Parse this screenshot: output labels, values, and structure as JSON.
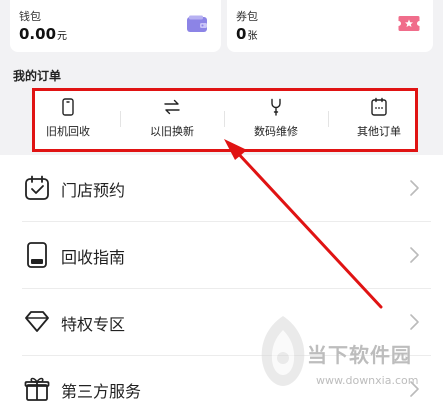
{
  "wallet": {
    "title": "钱包",
    "value": "0.00",
    "unit": "元",
    "icon": "wallet-icon",
    "icon_color": "#8c84e6"
  },
  "coupon": {
    "title": "券包",
    "value": "0",
    "unit": "张",
    "icon": "ticket-icon",
    "icon_color": "#f06d8b"
  },
  "orders": {
    "title": "我的订单",
    "highlight_color": "#e01313",
    "items": [
      {
        "label": "旧机回收",
        "icon": "phone-icon"
      },
      {
        "label": "以旧换新",
        "icon": "swap-icon"
      },
      {
        "label": "数码维修",
        "icon": "wrench-icon"
      },
      {
        "label": "其他订单",
        "icon": "order-icon"
      }
    ]
  },
  "menu": [
    {
      "label": "门店预约",
      "icon": "calendar-icon"
    },
    {
      "label": "回收指南",
      "icon": "guide-icon"
    },
    {
      "label": "特权专区",
      "icon": "diamond-icon"
    },
    {
      "label": "第三方服务",
      "icon": "gift-icon"
    }
  ],
  "watermark": {
    "text": "当下软件园",
    "url": "www.downxia.com"
  }
}
